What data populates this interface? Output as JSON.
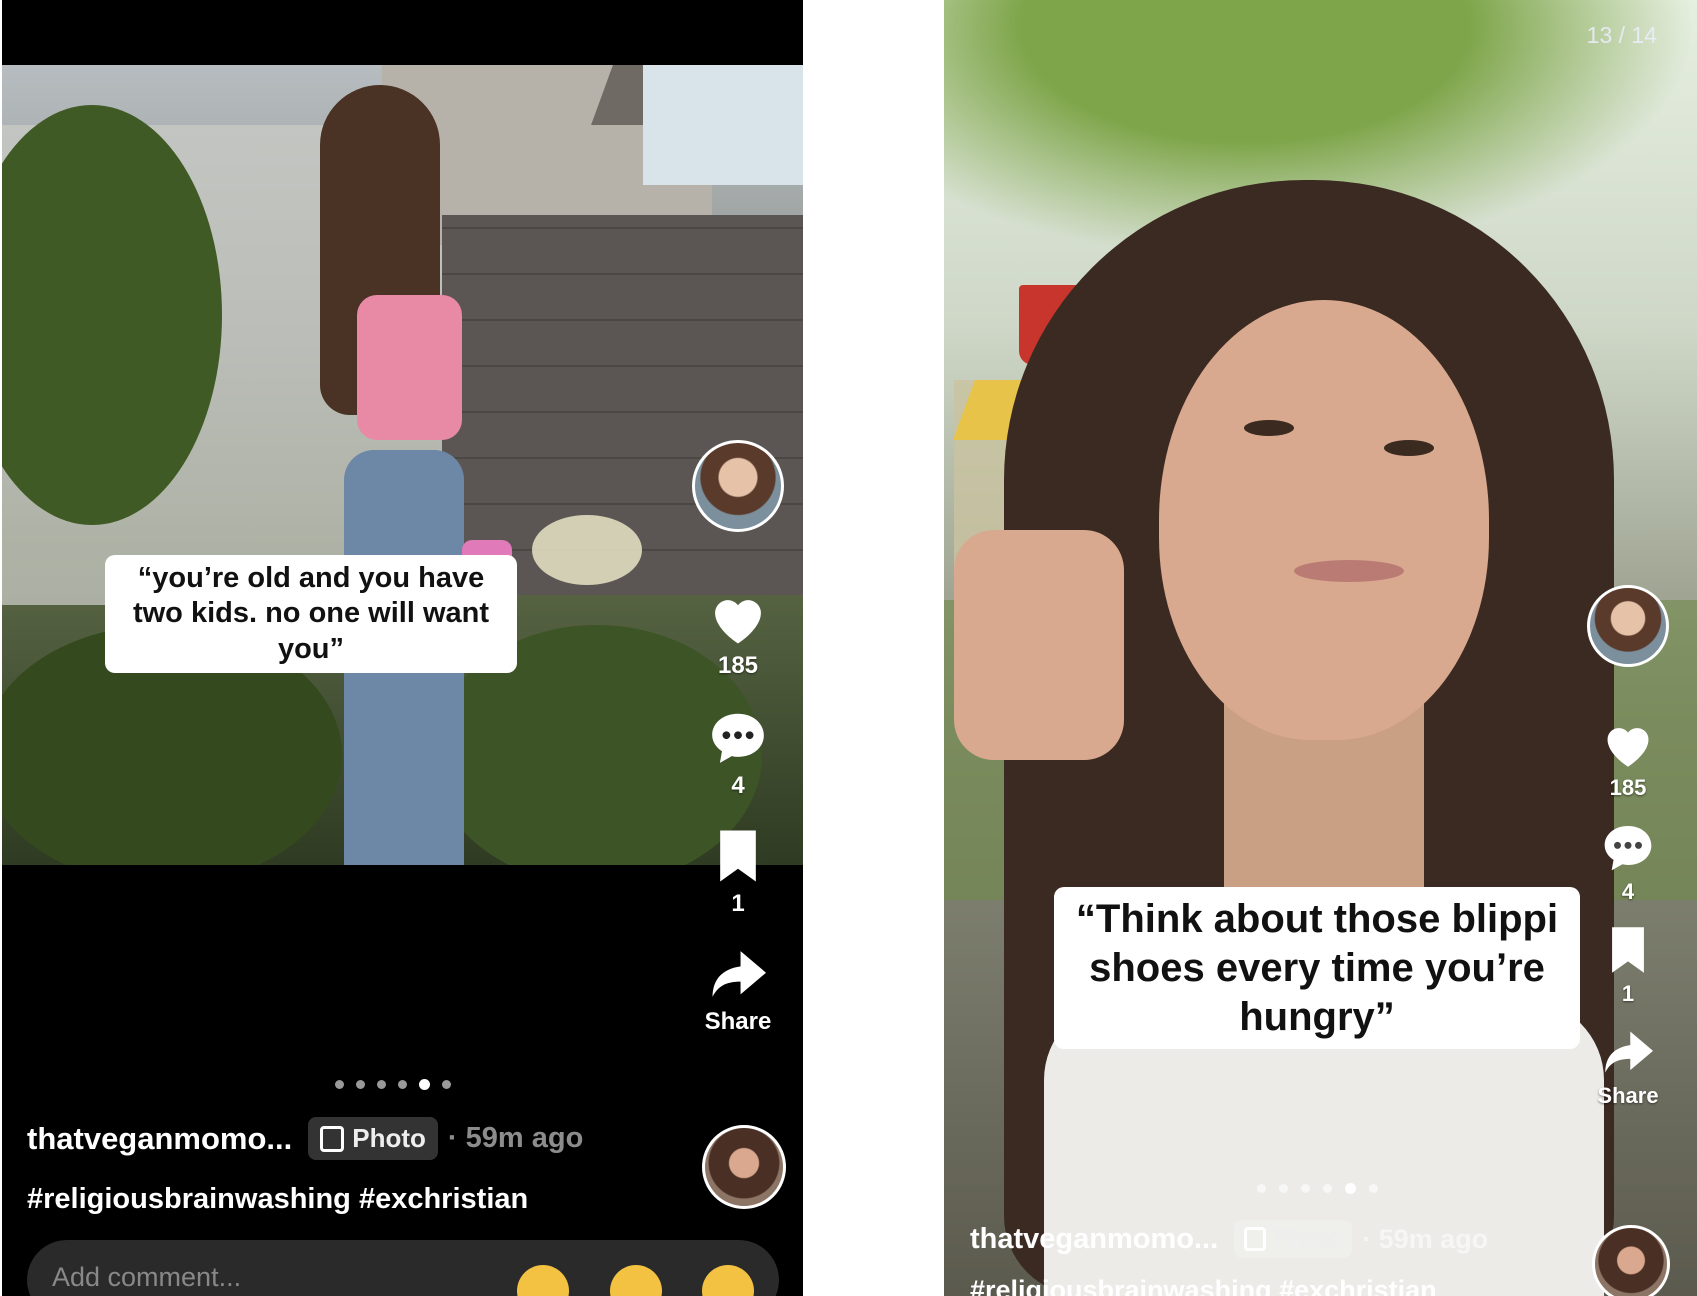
{
  "left_post": {
    "caption": "“you’re old and you have two kids. no one will want you”",
    "likes": "185",
    "comments": "4",
    "saves": "1",
    "share_label": "Share",
    "username": "thatveganmomo...",
    "post_type": "Photo",
    "time": "· 59m ago",
    "hashtags": "#religiousbrainwashing #exchristian",
    "comment_placeholder": "Add comment...",
    "dots_count": 6,
    "active_dot": 5
  },
  "right_post": {
    "counter": "13 / 14",
    "caption": "“Think about those blippi shoes every time you’re hungry”",
    "likes": "185",
    "comments": "4",
    "saves": "1",
    "share_label": "Share",
    "username": "thatveganmomo...",
    "post_type": "Photo",
    "time": "· 59m ago",
    "hashtags": "#religiousbrainwashing #exchristian",
    "dots_count": 6,
    "active_dot": 5
  },
  "icons": [
    "heart-icon",
    "comment-icon",
    "bookmark-icon",
    "share-icon",
    "photo-icon"
  ],
  "colors": {
    "background": "#000000",
    "text": "#ffffff",
    "caption_bg": "#ffffff"
  }
}
